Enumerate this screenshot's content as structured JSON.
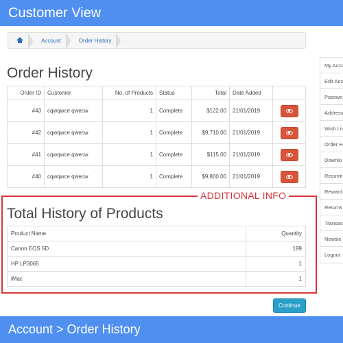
{
  "header": {
    "banner_title": "Customer View"
  },
  "breadcrumb": {
    "items": [
      "Account",
      "Order History"
    ]
  },
  "orders": {
    "title": "Order History",
    "columns": [
      "Order ID",
      "Customer",
      "No. of Products",
      "Status",
      "Total",
      "Date Added",
      ""
    ],
    "rows": [
      {
        "id": "#43",
        "customer": "cqwqwce qwecw",
        "products": "1",
        "status": "Complete",
        "total": "$122.00",
        "date": "21/01/2019"
      },
      {
        "id": "#42",
        "customer": "cqwqwce qwecw",
        "products": "1",
        "status": "Complete",
        "total": "$9,710.00",
        "date": "21/01/2019"
      },
      {
        "id": "#41",
        "customer": "cqwqwce qwecw",
        "products": "1",
        "status": "Complete",
        "total": "$115.00",
        "date": "21/01/2019"
      },
      {
        "id": "#40",
        "customer": "cqwqwce qwecw",
        "products": "1",
        "status": "Complete",
        "total": "$9,800.00",
        "date": "21/01/2019"
      }
    ]
  },
  "additional": {
    "label": "ADDITIONAL INFO",
    "title": "Total History of Products",
    "columns": [
      "Product Name",
      "Quantity"
    ],
    "rows": [
      {
        "name": "Canon EOS 5D",
        "qty": "199"
      },
      {
        "name": "HP LP3065",
        "qty": "1"
      },
      {
        "name": "iMac",
        "qty": "1"
      }
    ]
  },
  "actions": {
    "continue_label": "Continue"
  },
  "sidebar": {
    "items": [
      "My Acco",
      "Edit Acc",
      "Passwo",
      "Address",
      "Wish Lis",
      "Order H",
      "Downlo",
      "Recurrin",
      "Reward",
      "Returns",
      "Transac",
      "Newsle",
      "Logout"
    ]
  },
  "footer": {
    "banner_caption": "Account > Order History"
  },
  "colors": {
    "banner": "#4f8ff0",
    "view_button": "#d9553a",
    "continue_button": "#2a9fc9",
    "highlight_border": "#d9343a"
  },
  "icons": {
    "home": "home-icon",
    "view": "eye-icon"
  }
}
